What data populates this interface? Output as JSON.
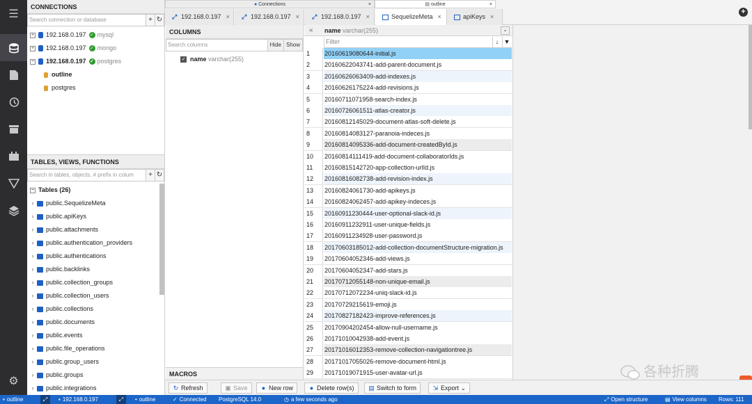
{
  "connections": {
    "title": "CONNECTIONS",
    "search_placeholder": "Search connection or database",
    "items": [
      {
        "host": "192.168.0.197",
        "type": "mysql"
      },
      {
        "host": "192.168.0.197",
        "type": "mongo"
      },
      {
        "host": "192.168.0.197",
        "type": "postgres"
      }
    ],
    "databases": [
      "outline",
      "postgres"
    ]
  },
  "tables_panel": {
    "title": "TABLES, VIEWS, FUNCTIONS",
    "search_placeholder": "Search in tables, objects, # prefix in colum",
    "group_label": "Tables (26)",
    "tables": [
      "public.SequelizeMeta",
      "public.apiKeys",
      "public.attachments",
      "public.authentication_providers",
      "public.authentications",
      "public.backlinks",
      "public.collection_groups",
      "public.collection_users",
      "public.collections",
      "public.documents",
      "public.events",
      "public.file_operations",
      "public.group_users",
      "public.groups",
      "public.integrations"
    ]
  },
  "top_tabs": [
    {
      "label": "Connections",
      "close": "×"
    },
    {
      "label": "outline",
      "close": "×"
    }
  ],
  "tabs": [
    {
      "label": "192.168.0.197",
      "close": "×"
    },
    {
      "label": "192.168.0.197",
      "close": "×"
    },
    {
      "label": "192.168.0.197",
      "close": "×"
    },
    {
      "label": "SequelizeMeta",
      "close": "×"
    },
    {
      "label": "apiKeys",
      "close": "×"
    }
  ],
  "columns_panel": {
    "title": "COLUMNS",
    "search_placeholder": "Search columns",
    "hide_label": "Hide",
    "show_label": "Show",
    "column_name": "name",
    "column_type": "varchar(255)",
    "collapse_symbol": "«"
  },
  "macros_label": "MACROS",
  "grid": {
    "column_name": "name",
    "column_type": "varchar(255)",
    "filter_placeholder": "Filter",
    "rows": [
      "20160619080644-initial.js",
      "20160622043741-add-parent-document.js",
      "20160626063409-add-indexes.js",
      "20160626175224-add-revisions.js",
      "20160711071958-search-index.js",
      "20160726061511-atlas-creator.js",
      "20160812145029-document-atlas-soft-delete.js",
      "20160814083127-paranoia-indeces.js",
      "20160814095336-add-document-createdById.js",
      "20160814111419-add-document-collaboratorIds.js",
      "20160815142720-app-collection-urlId.js",
      "20160816082738-add-revision-index.js",
      "20160824061730-add-apikeys.js",
      "20160824062457-add-apikey-indeces.js",
      "20160911230444-user-optional-slack-id.js",
      "20160911232911-user-unique-fields.js",
      "20160911234928-user-password.js",
      "20170603185012-add-collection-documentStructure-migration.js",
      "20170604052346-add-views.js",
      "20170604052347-add-stars.js",
      "20170712055148-non-unique-email.js",
      "20170712072234-uniq-slack-id.js",
      "20170729215619-emoji.js",
      "20170827182423-improve-references.js",
      "20170904202454-allow-null-username.js",
      "20171010042938-add-event.js",
      "20171016012353-remove-collection-navigationtree.js",
      "20171017055026-remove-document-html.js",
      "20171019071915-user-avatar-url.js"
    ]
  },
  "toolbar": {
    "refresh": "Refresh",
    "save": "Save",
    "new_row": "New row",
    "delete_rows": "Delete row(s)",
    "switch_form": "Switch to form",
    "export": "Export"
  },
  "status": {
    "db": "outline",
    "host": "192.168.0.197",
    "db2": "outline",
    "connected": "Connected",
    "version": "PostgreSQL 14.0",
    "time": "a few seconds ago",
    "open_structure": "Open structure",
    "view_columns": "View columns",
    "rows": "Rows: 111"
  },
  "watermark": "各种折腾",
  "colors": {
    "accent": "#1c66c9",
    "selection": "#91d1f7",
    "sidebar": "#2d2d30"
  }
}
